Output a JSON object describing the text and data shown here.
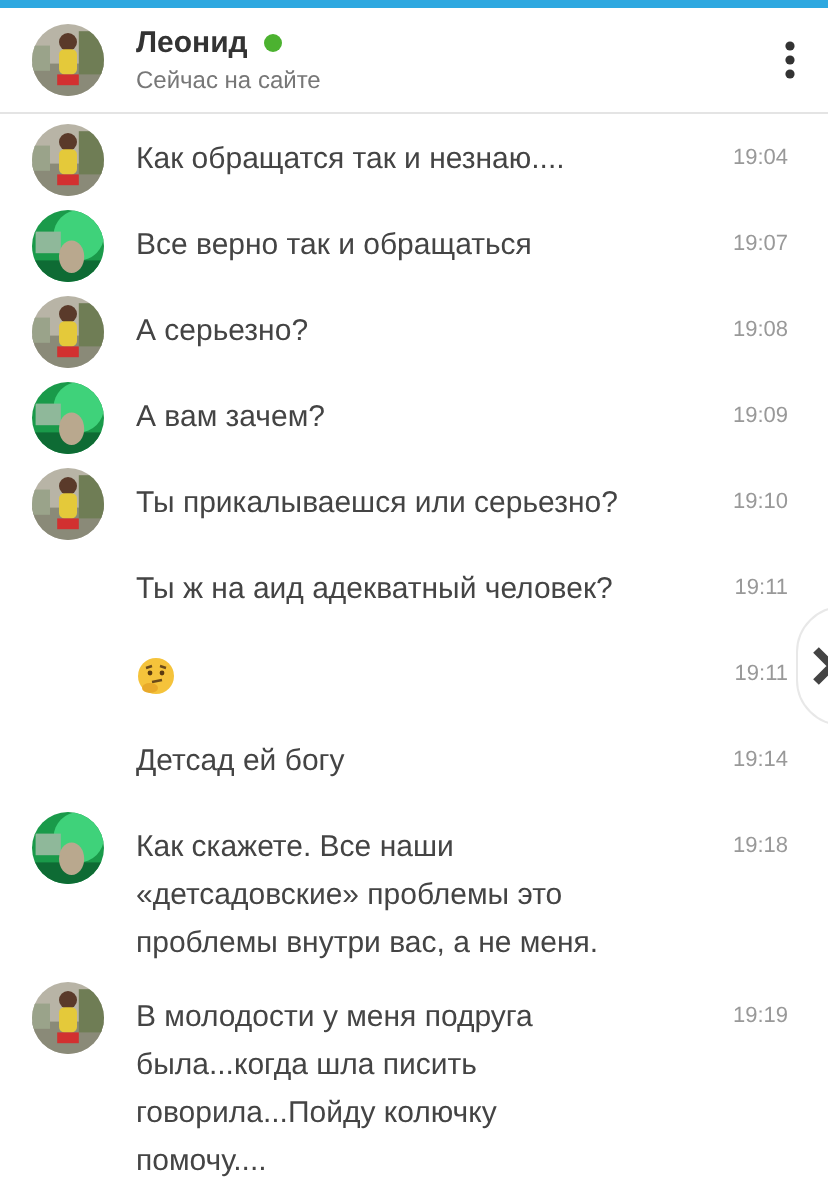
{
  "header": {
    "name": "Леонид",
    "online": true,
    "status": "Сейчас на сайте"
  },
  "messages": [
    {
      "avatar": true,
      "kind": "text",
      "text": "Как обращатся так и незнаю....",
      "time": "19:04"
    },
    {
      "avatar": true,
      "kind": "text",
      "text": "Все верно так и обращаться",
      "time": "19:07"
    },
    {
      "avatar": true,
      "kind": "text",
      "text": "А серьезно?",
      "time": "19:08"
    },
    {
      "avatar": true,
      "kind": "text",
      "text": "А вам зачем?",
      "time": "19:09"
    },
    {
      "avatar": true,
      "kind": "text",
      "text": "Ты прикалываешся или серьезно?",
      "time": "19:10"
    },
    {
      "avatar": false,
      "kind": "text",
      "text": "Ты ж на аид адекватный человек?",
      "time": "19:11"
    },
    {
      "avatar": false,
      "kind": "emoji",
      "time": "19:11"
    },
    {
      "avatar": false,
      "kind": "text",
      "text": "Детсад ей богу",
      "time": "19:14"
    },
    {
      "avatar": true,
      "kind": "text",
      "text": "Как скажете. Все наши «детсадовские» проблемы это проблемы внутри вас, а не меня.",
      "time": "19:18"
    },
    {
      "avatar": true,
      "kind": "text",
      "text": "В молодости у меня подруга была...когда шла писить говорила...Пойду колючку помочу....",
      "time": "19:19"
    }
  ]
}
